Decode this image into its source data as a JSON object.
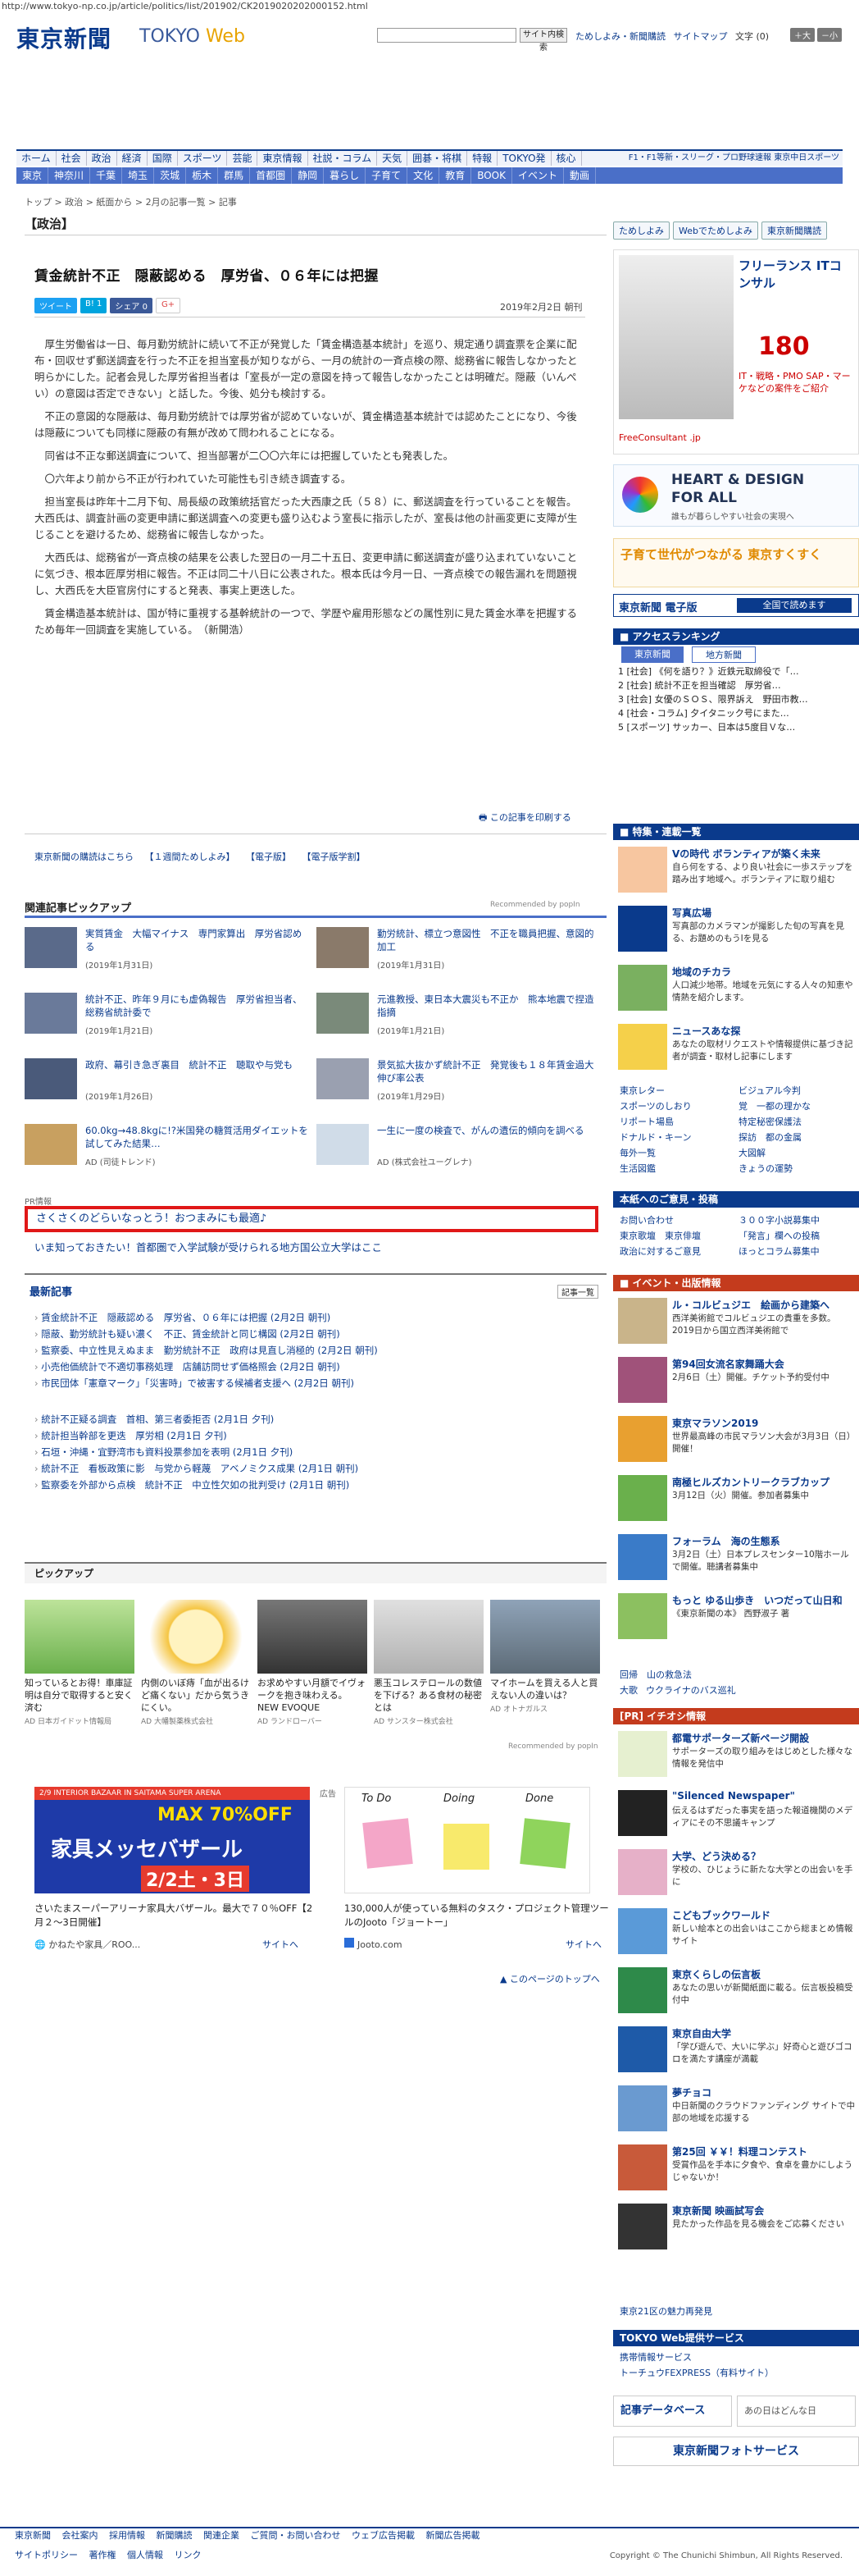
{
  "url": "http://www.tokyo-np.co.jp/article/politics/list/201902/CK2019020202000152.html",
  "header": {
    "logo": "東京新聞",
    "logo_tokyo": "TOKYO",
    "logo_web": "Web",
    "search_button": "サイト内検索",
    "links": [
      "ためしよみ・新聞購読",
      "サイトマップ"
    ],
    "font_label": "文字 (0)",
    "font_plus": "＋大",
    "font_minus": "－小"
  },
  "nav1": [
    "ホーム",
    "社会",
    "政治",
    "経済",
    "国際",
    "スポーツ",
    "芸能",
    "東京情報",
    "社説・コラム",
    "天気",
    "囲碁・将棋",
    "特報",
    "TOKYO発",
    "核心"
  ],
  "nav1_right": "F1・F1等新・スリーグ・プロ野球速報 東京中日スポーツ",
  "nav2": [
    "東京",
    "神奈川",
    "千葉",
    "埼玉",
    "茨城",
    "栃木",
    "群馬",
    "首都圏",
    "静岡",
    "暮らし",
    "子育て",
    "文化",
    "教育",
    "BOOK",
    "イベント",
    "動画"
  ],
  "breadcrumb": "トップ > 政治 > 紙面から > 2月の記事一覧 > 記事",
  "section": "【政治】",
  "article": {
    "title": "賃金統計不正　隠蔽認める　厚労省、０６年には把握",
    "share": [
      "ツイート",
      "B! 1",
      "シェア 0",
      "G+"
    ],
    "date": "2019年2月2日 朝刊",
    "paragraphs": [
      "厚生労働省は一日、毎月勤労統計に続いて不正が発覚した「賃金構造基本統計」を巡り、規定通り調査票を企業に配布・回収せず郵送調査を行った不正を担当室長が知りながら、一月の統計の一斉点検の際、総務省に報告しなかったと明らかにした。記者会見した厚労省担当者は「室長が一定の意図を持って報告しなかったことは明確だ。隠蔽（いんぺい）の意図は否定できない」と話した。今後、処分も検討する。",
      "不正の意図的な隠蔽は、毎月勤労統計では厚労省が認めていないが、賃金構造基本統計では認めたことになり、今後は隠蔽についても同様に隠蔽の有無が改めて問われることになる。",
      "同省は不正な郵送調査について、担当部署が二〇〇六年には把握していたとも発表した。",
      "〇六年より前から不正が行われていた可能性も引き続き調査する。",
      "担当室長は昨年十二月下旬、局長級の政策統括官だった大西康之氏（５８）に、郵送調査を行っていることを報告。大西氏は、調査計画の変更申請に郵送調査への変更も盛り込むよう室長に指示したが、室長は他の計画変更に支障が生じることを避けるため、総務省に報告しなかった。",
      "大西氏は、総務省が一斉点検の結果を公表した翌日の一月二十五日、変更申請に郵送調査が盛り込まれていないことに気づき、根本匠厚労相に報告。不正は同二十八日に公表された。根本氏は今月一日、一斉点検での報告漏れを問題視し、大西氏を大臣官房付にすると発表、事実上更迭した。",
      "賃金構造基本統計は、国が特に重視する基幹統計の一つで、学歴や雇用形態などの属性別に見た賃金水準を把握するため毎年一回調査を実施している。　（新開浩）"
    ],
    "print": "この記事を印刷する"
  },
  "sublinks": [
    "東京新聞の購読はこちら",
    "【１週間ためしよみ】",
    "【電子版】",
    "【電子版学割】"
  ],
  "related": {
    "heading": "関連記事ピックアップ",
    "recommended": "Recommended by popIn",
    "items": [
      {
        "title": "実質賃金　大幅マイナス　専門家算出　厚労省認める",
        "date": "(2019年1月31日)"
      },
      {
        "title": "勤労統計、標立つ意図性　不正を職員把握、意図的加工",
        "date": "(2019年1月31日)"
      },
      {
        "title": "統計不正、昨年９月にも虚偽報告　厚労省担当者、総務省統計委で",
        "date": "(2019年1月21日)"
      },
      {
        "title": "元進教授、東日本大震災も不正か　熊本地震で捏造指摘",
        "date": "(2019年1月21日)"
      },
      {
        "title": "政府、幕引き急ぎ裏目　統計不正　聴取や与党も",
        "date": "(2019年1月26日)"
      },
      {
        "title": "景気拡大抜かず統計不正　発覚後も１８年賃金過大伸び率公表",
        "date": "(2019年1月29日)"
      },
      {
        "title": "60.0kg→48.8kgに!?米国発の糖質活用ダイエットを試してみた結果…",
        "date": "AD (司徒トレンド)"
      },
      {
        "title": "一生に一度の検査で、がんの遺伝的傾向を調べる",
        "date": "AD (株式会社ユーグレナ)"
      }
    ]
  },
  "pr": {
    "label": "PR情報",
    "box": "さくさくのどらいなっとう！おつまみにも最適♪",
    "line": "いま知っておきたい！首都圏で入学試験が受けられる地方国公立大学はここ"
  },
  "latest": {
    "heading": "最新記事",
    "more": "記事一覧",
    "group1": [
      "賃金統計不正　隠蔽認める　厚労省、０６年には把握 (2月2日 朝刊)",
      "隠蔽、勤労統計も疑い濃く　不正、賃金統計と同じ構図 (2月2日 朝刊)",
      "監察委、中立性見えぬまま　勤労統計不正　政府は見直し消極的 (2月2日 朝刊)",
      "小売他価統計で不適切事務処理　店舗訪問せず価格照会 (2月2日 朝刊)",
      "市民団体「憲章マーク」「災害時」で被害する候補者支援へ (2月2日 朝刊)"
    ],
    "group2": [
      "統計不正疑る調査　首相、第三者委拒否 (2月1日 夕刊)",
      "統計担当幹部を更迭　厚労相 (2月1日 夕刊)",
      "石垣・沖縄・宜野湾市も資料投票参加を表明 (2月1日 夕刊)",
      "統計不正　看板政策に影　与党から軽蔑　アベノミクス成果 (2月1日 朝刊)",
      "監察委を外部から点検　統計不正　中立性欠如の批判受け (2月1日 朝刊)"
    ]
  },
  "pickup": {
    "heading": "ピックアップ",
    "items": [
      {
        "text": "知っているとお得！車庫証明は自分で取得すると安く済む",
        "ad": "AD 日本ガイドット情報局"
      },
      {
        "text": "内側のいぼ痔「血が出るけど痛くない」だから気うきにくい。",
        "ad": "AD 大幡製薬株式会社"
      },
      {
        "text": "お求めやすい月額でイヴォークを抱き味わえる。NEW EVOQUE",
        "ad": "AD ランドローバー"
      },
      {
        "text": "悪玉コレステロールの数値を下げる？ある食材の秘密とは",
        "ad": "AD サンスター株式会社"
      },
      {
        "text": "マイホームを買える人と買えない人の違いは？",
        "ad": "AD オトナガルス"
      }
    ],
    "recommended": "Recommended by popIn"
  },
  "ads": {
    "left_caption": "さいたまスーパーアリーナ家具大バザール。最大で７０％OFF【2月２～3日開催】",
    "left_source": "かねたや家具／ROO...",
    "left_site": "サイトへ",
    "right_label": "広告",
    "right_caption": "130,000人が使っている無料のタスク・プロジェクト管理ツールのJooto「ジョートー」",
    "right_source": "Jooto.com",
    "right_site": "サイトへ",
    "right_cols": [
      "To Do",
      "Doing",
      "Done"
    ],
    "banner_top": "2/9 INTERIOR BAZAAR IN SAITAMA SUPER ARENA",
    "banner_off": "MAX 70%OFF",
    "banner_main": "家具メッセバザール",
    "banner_date": "2/2土・3日",
    "back_top": "このページのトップへ"
  },
  "side": {
    "btns": [
      "ためしよみ",
      "Webでためしよみ",
      "東京新聞購読"
    ],
    "ad_title": "フリーランス ITコンサル",
    "ad_price": "180",
    "ad_sub": "IT・戦略・PMO SAP・マーケなどの案件をご紹介",
    "ad_brand": "FreeConsultant .jp",
    "heart1": "HEART & DESIGN",
    "heart2": "FOR ALL",
    "heart_sub": "誰もが暮らしやすい社会の実現へ",
    "sukusuku": "子育て世代がつながる 東京すくすく",
    "shimbun_btn": "東京新聞 電子版",
    "shimbun_btn2": "全国で読めます",
    "ranking_head": "アクセスランキング",
    "rank_tabs": [
      "東京新聞",
      "地方新聞"
    ],
    "ranking": [
      "1 [社会] 《何を語り？》近鉄元取締役で「…",
      "2 [社会] 統計不正を担当確認　厚労省…",
      "3 [社会] 女優のＳＯＳ、限界訴え　野田市教…",
      "4 [社会・コラム] 夕イタニック号にまた…",
      "5 [スポーツ] サッカー、日本は5度目Ｖな…"
    ],
    "toku_head": "特集・連載一覧",
    "toku": [
      {
        "t": "Vの時代 ボランティアが築く未来",
        "d": "自ら何をする、より良い社会に一歩ステップを踏み出す地域へ。ボランティアに取り組む"
      },
      {
        "t": "写真広場",
        "d": "写真部のカメラマンが撮影した旬の写真を見る、お題めのもうIを見る"
      },
      {
        "t": "地域のチカラ",
        "d": "人口減少地帯。地域を元気にする人々の知恵や情熱を紹介します。"
      },
      {
        "t": "ニュースあな探",
        "d": "あなたの取材リクエストや情報提供に基づき記者が調査・取材し記事にします"
      }
    ],
    "grid": [
      [
        "東京レター",
        "ビジュアル今判"
      ],
      [
        "スポーツのしおり",
        "覚　一都の理かな"
      ],
      [
        "リポート場島",
        "特定秘密保護法"
      ],
      [
        "ドナルド・キーン",
        "探訪　都の金属"
      ],
      [
        "毎外一覧",
        "大図解"
      ],
      [
        "生活図鑑",
        "きょうの運勢"
      ]
    ],
    "toku2_head": "本紙へのご意見・投稿",
    "toku2": [
      [
        "お問い合わせ",
        "３００字小説募集中"
      ],
      [
        "東京歌壇　東京俳壇",
        "「発言」欄への投稿"
      ],
      [
        "政治に対するご意見",
        "ほっとコラム募集中"
      ]
    ],
    "event_head": "イベント・出版情報",
    "events": [
      {
        "t": "ル・コルビュジエ　絵画から建築へ",
        "d": "西洋美術館でコルビュジエの貴重を多数。2019日から国立西洋美術館で"
      },
      {
        "t": "第94回女流名家舞踊大会",
        "d": "2月6日（土）開催。チケット予約受付中"
      },
      {
        "t": "東京マラソン2019",
        "d": "世界最高峰の市民マラソン大会が3月3日（日）開催！"
      },
      {
        "t": "南極ヒルズカントリークラブカップ",
        "d": "3月12日（火）開催。参加者募集中"
      },
      {
        "t": "フォーラム　海の生態系",
        "d": "3月2日（土）日本プレスセンター10階ホールで開催。聴講者募集中"
      },
      {
        "t": "もっと ゆる山歩き　いつだって山日和",
        "d": "《東京新聞の本》 西野淑子 著"
      }
    ],
    "events_more": [
      "回帰　山の救急法",
      "大歌",
      "ウクライナのバス巡礼"
    ],
    "pr_head": "[PR] イチオシ情報",
    "prs": [
      {
        "t": "都電サポーターズ新ページ開設",
        "d": "サポーターズの取り組みをはじめとした様々な情報を発信中"
      },
      {
        "t": "\"Silenced Newspaper\"",
        "d": "伝えるはずだった事実を語った報道機関のメディアにその不思議キャンプ"
      },
      {
        "t": "大学、どう決める？",
        "d": "学校の、ひじょうに新たな大学との出会いを手に"
      },
      {
        "t": "こどもブックワールド",
        "d": "新しい絵本との出会いはここから総まとめ情報サイト"
      },
      {
        "t": "東京くらしの伝言板",
        "d": "あなたの思いが新聞紙面に載る。伝言板投稿受付中"
      },
      {
        "t": "東京自由大学",
        "d": "「学び遊んで、大いに学ぶ」好奇心と遊びゴコロを満たす講座が満載"
      },
      {
        "t": "夢チョコ",
        "d": "中日新聞のクラウドファンディング サイトで中部の地域を応援する"
      },
      {
        "t": "第25回 ￥￥！料理コンテスト",
        "d": "受賞作品を手本に夕食や、食卓を豊かにしようじゃないか！"
      },
      {
        "t": "東京新聞 映画試写会",
        "d": "見たかった作品を見る機会をご応募ください"
      }
    ],
    "pr_more": "東京21区の魅力再発見",
    "service_head": "TOKYO Web提供サービス",
    "services": [
      "携帯情報サービス",
      "トーチュウFEXPRESS（有料サイト）"
    ],
    "db1": "記事データベース",
    "db2": "あの日はどんな日",
    "photo": "東京新聞フォトサービス"
  },
  "footer": {
    "links1": [
      "東京新聞",
      "会社案内",
      "採用情報",
      "新聞購読",
      "関連企業",
      "ご質問・お問い合わせ",
      "ウェブ広告掲載",
      "新聞広告掲載"
    ],
    "links2": [
      "サイトポリシー",
      "著作権",
      "個人情報",
      "リンク"
    ],
    "copyright": "Copyright © The Chunichi Shimbun, All Rights Reserved."
  },
  "colors": {
    "brand": "#0a3a8c",
    "nav2": "#4a6fc8",
    "pr_border": "#e01818"
  }
}
